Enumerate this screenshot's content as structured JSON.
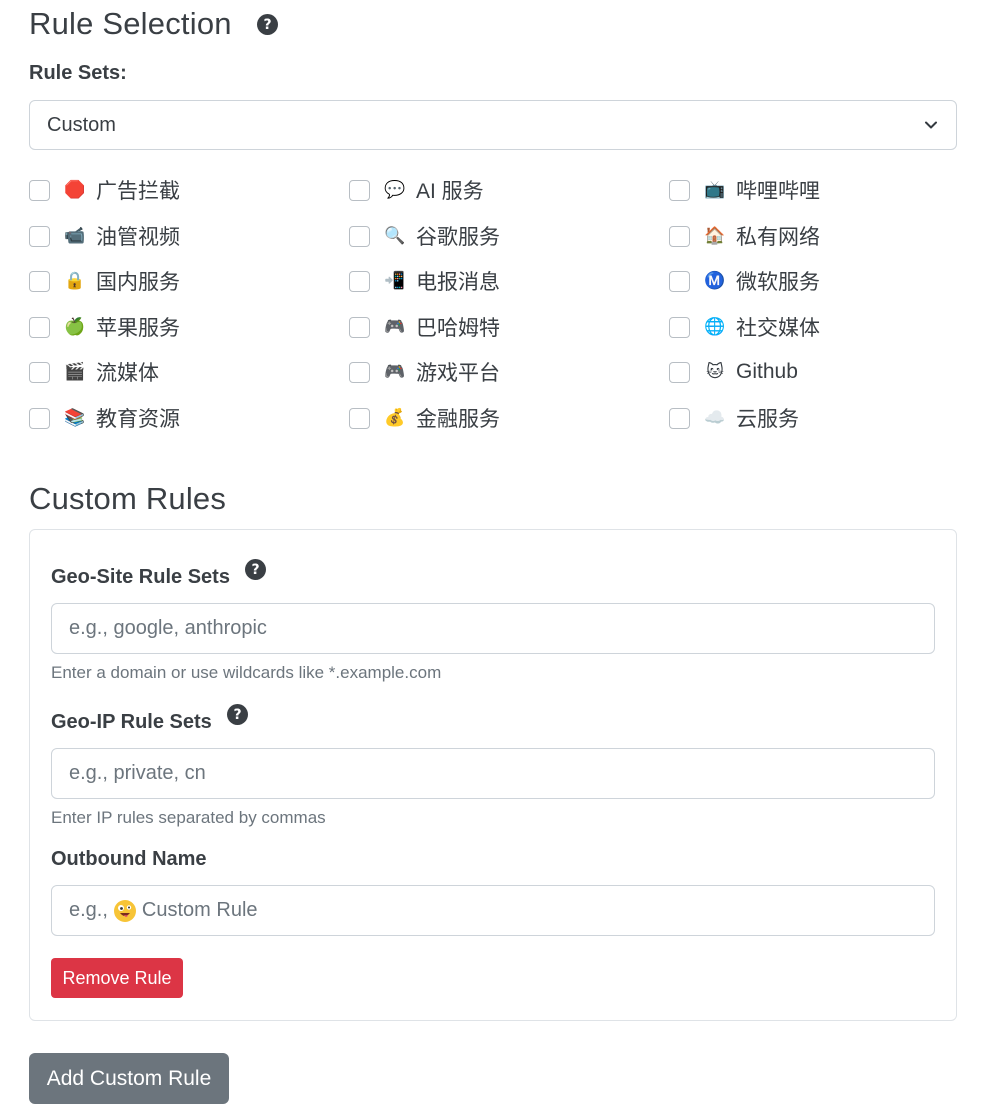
{
  "rule_selection": {
    "title": "Rule Selection",
    "rule_sets_label": "Rule Sets:",
    "selected_rule_set": "Custom",
    "items": [
      {
        "label": "广告拦截",
        "icon": "stop-sign-icon",
        "glyph": "🛑",
        "checked": false
      },
      {
        "label": "AI 服务",
        "icon": "speech-bubble-icon",
        "glyph": "💬",
        "checked": false
      },
      {
        "label": "哔哩哔哩",
        "icon": "tv-icon",
        "glyph": "📺",
        "checked": false
      },
      {
        "label": "油管视频",
        "icon": "video-camera-icon",
        "glyph": "📹",
        "checked": false
      },
      {
        "label": "谷歌服务",
        "icon": "magnifier-icon",
        "glyph": "🔍",
        "checked": false
      },
      {
        "label": "私有网络",
        "icon": "house-icon",
        "glyph": "🏠",
        "checked": false
      },
      {
        "label": "国内服务",
        "icon": "lock-icon",
        "glyph": "🔒",
        "checked": false
      },
      {
        "label": "电报消息",
        "icon": "mobile-phone-arrow-icon",
        "glyph": "📲",
        "checked": false
      },
      {
        "label": "微软服务",
        "icon": "m-circle-icon",
        "glyph": "Ⓜ️",
        "checked": false
      },
      {
        "label": "苹果服务",
        "icon": "apple-icon",
        "glyph": "🍏",
        "checked": false
      },
      {
        "label": "巴哈姆特",
        "icon": "game-controller-icon",
        "glyph": "🎮",
        "checked": false
      },
      {
        "label": "社交媒体",
        "icon": "globe-icon",
        "glyph": "🌐",
        "checked": false
      },
      {
        "label": "流媒体",
        "icon": "clapperboard-icon",
        "glyph": "🎬",
        "checked": false
      },
      {
        "label": "游戏平台",
        "icon": "game-controller-icon",
        "glyph": "🎮",
        "checked": false
      },
      {
        "label": "Github",
        "icon": "cat-face-icon",
        "glyph": "🐱",
        "checked": false
      },
      {
        "label": "教育资源",
        "icon": "books-icon",
        "glyph": "📚",
        "checked": false
      },
      {
        "label": "金融服务",
        "icon": "money-bag-icon",
        "glyph": "💰",
        "checked": false
      },
      {
        "label": "云服务",
        "icon": "cloud-icon",
        "glyph": "☁️",
        "checked": false
      }
    ]
  },
  "custom_rules": {
    "title": "Custom Rules",
    "geo_site_label": "Geo-Site Rule Sets",
    "geo_site_placeholder": "e.g., google, anthropic",
    "geo_site_help": "Enter a domain or use wildcards like *.example.com",
    "geo_ip_label": "Geo-IP Rule Sets",
    "geo_ip_placeholder": "e.g., private, cn",
    "geo_ip_help": "Enter IP rules separated by commas",
    "outbound_label": "Outbound Name",
    "outbound_placeholder_prefix": "e.g.,",
    "outbound_placeholder_suffix": "Custom Rule",
    "remove_button": "Remove Rule",
    "add_button": "Add Custom Rule"
  },
  "colors": {
    "danger": "#dc3545",
    "secondary": "#6c757d",
    "text": "#3a3f44",
    "border": "#ced4da"
  }
}
